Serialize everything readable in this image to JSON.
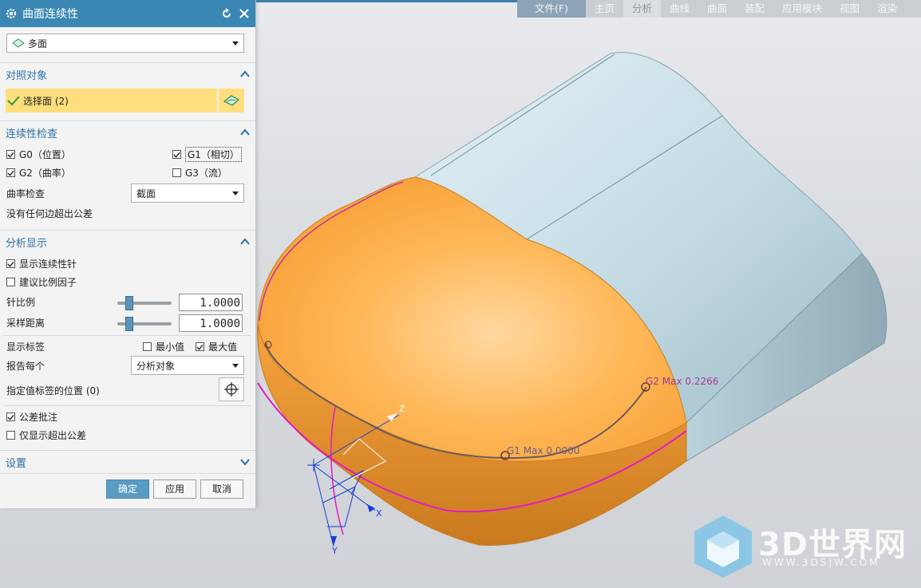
{
  "ribbon": {
    "tabs": [
      "文件(F)",
      "主页",
      "分析",
      "曲线",
      "曲面",
      "装配",
      "应用模块",
      "视图",
      "渲染"
    ]
  },
  "dialog": {
    "title": "曲面连续性",
    "type_select": "多面",
    "reference": {
      "header": "对照对象",
      "selection": "选择面 (2)"
    },
    "continuity": {
      "header": "连续性检查",
      "g0": "G0（位置）",
      "g1": "G1（相切）",
      "g2": "G2（曲率）",
      "g3": "G3（流）",
      "curvature_label": "曲率检查",
      "curvature_value": "截面",
      "status": "没有任何边超出公差"
    },
    "display": {
      "header": "分析显示",
      "show_needles": "显示连续性针",
      "suggest_scale": "建议比例因子",
      "needle_scale_label": "针比例",
      "needle_scale_value": "1.0000",
      "sample_dist_label": "采样距离",
      "sample_dist_value": "1.0000",
      "show_labels": "显示标签",
      "min_label": "最小值",
      "max_label": "最大值",
      "report_each_label": "报告每个",
      "report_each_value": "分析对象",
      "label_pos": "指定值标签的位置 (0)",
      "tol_note": "公差批注",
      "only_out_tol": "仅显示超出公差"
    },
    "settings": {
      "header": "设置"
    },
    "buttons": {
      "ok": "确定",
      "apply": "应用",
      "cancel": "取消"
    }
  },
  "viewport": {
    "g2_label": "G2 Max 0.2266",
    "g1_label": "G1 Max 0.0000",
    "axis_x": "X",
    "axis_y": "Y",
    "axis_z": "Z",
    "watermark_title": "3D世界网",
    "watermark_url": "WWW.3DSJW.COM"
  },
  "colors": {
    "accent": "#3a87b3",
    "selection_bg": "#ffde7e",
    "orange_surface": "#f7a540",
    "blue_surface": "#c5dde5",
    "magenta_line": "#e419c6"
  }
}
